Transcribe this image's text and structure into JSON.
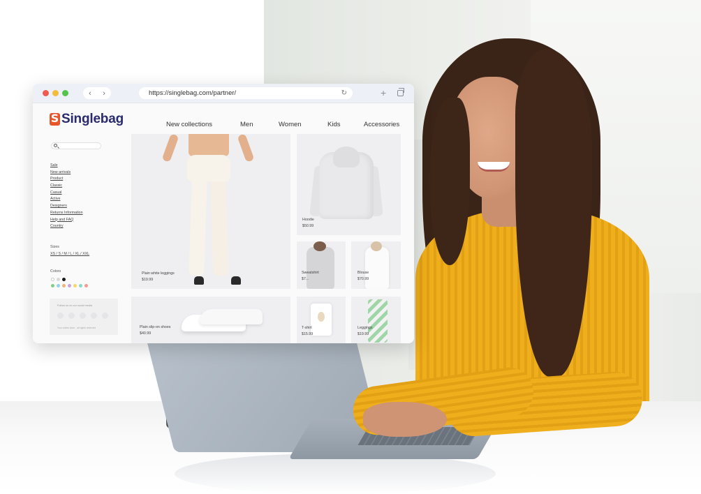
{
  "browser": {
    "url": "https://singlebag.com/partner/",
    "back_icon": "chevron-left-icon",
    "forward_icon": "chevron-right-icon",
    "reload_icon": "reload-icon",
    "new_tab_icon": "plus-icon",
    "tabs_icon": "tabs-icon"
  },
  "site": {
    "brand": "Singlebag",
    "brand_color": "#2a2a6e",
    "logo_color": "#e8552b"
  },
  "nav": {
    "items": [
      "New collections",
      "Men",
      "Women",
      "Kids",
      "Accessories"
    ]
  },
  "sidebar": {
    "links": [
      "Sale",
      "New arrivals",
      "Product",
      "Classic",
      "Casual",
      "Active",
      "Designers",
      "Returns Information",
      "Help and FAQ",
      "Country"
    ],
    "sizes_label": "Sizes",
    "sizes": "XS / S / M / L / XL / XXL",
    "colors_label": "Colors",
    "swatches": [
      "#ffffff",
      "#d9d9d9",
      "#1a1a1a",
      "#7fcf8a",
      "#9ad0e8",
      "#f2b27a",
      "#c9a3e6",
      "#f5d66b",
      "#8fd6c7",
      "#f39a8f"
    ]
  },
  "footer": {
    "follow_text": "Follow us on our social media",
    "copyright": "Your online store - all rights reserved"
  },
  "products": [
    {
      "name": "Plain white leggings",
      "price": "$19.99"
    },
    {
      "name": "Hoodie",
      "price": "$50.99"
    },
    {
      "name": "Sweatshirt",
      "price": "$7..."
    },
    {
      "name": "Blouse",
      "price": "$70.99"
    },
    {
      "name": "Plain slip-on shoes",
      "price": "$40.99"
    },
    {
      "name": "T-shirt",
      "price": "$15.99"
    },
    {
      "name": "Leggings",
      "price": "$19.99"
    }
  ]
}
